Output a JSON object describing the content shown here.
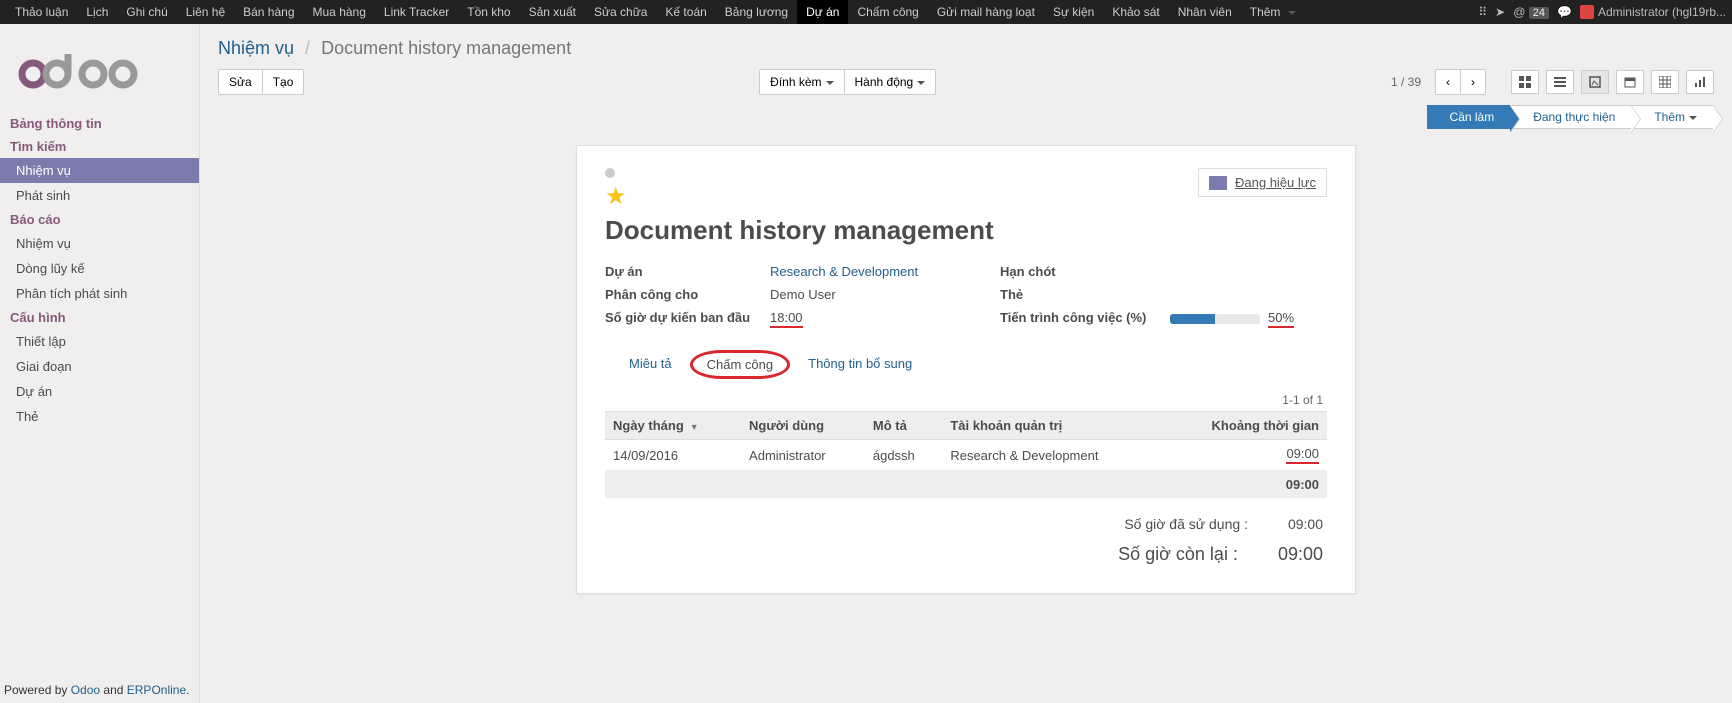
{
  "topmenu": [
    "Thảo luận",
    "Lịch",
    "Ghi chú",
    "Liên hệ",
    "Bán hàng",
    "Mua hàng",
    "Link Tracker",
    "Tồn kho",
    "Sản xuất",
    "Sửa chữa",
    "Kế toán",
    "Bảng lương",
    "Dự án",
    "Chấm công",
    "Gửi mail hàng loạt",
    "Sự kiện",
    "Khảo sát",
    "Nhân viên",
    "Thêm"
  ],
  "topmenu_active_index": 12,
  "sys": {
    "notif_count": "24",
    "user_label": "Administrator (hgl19rb..."
  },
  "sidebar": {
    "sections": [
      {
        "type": "header",
        "label": "Bảng thông tin"
      },
      {
        "type": "header",
        "label": "Tìm kiếm"
      },
      {
        "type": "item",
        "label": "Nhiệm vụ",
        "active": true
      },
      {
        "type": "item",
        "label": "Phát sinh"
      },
      {
        "type": "header",
        "label": "Báo cáo"
      },
      {
        "type": "item",
        "label": "Nhiệm vụ"
      },
      {
        "type": "item",
        "label": "Dòng lũy kế"
      },
      {
        "type": "item",
        "label": "Phân tích phát sinh"
      },
      {
        "type": "header",
        "label": "Cấu hình"
      },
      {
        "type": "item",
        "label": "Thiết lập"
      },
      {
        "type": "item",
        "label": "Giai đoạn"
      },
      {
        "type": "item",
        "label": "Dự án"
      },
      {
        "type": "item",
        "label": "Thẻ"
      }
    ]
  },
  "powered": {
    "prefix": "Powered by ",
    "a1": "Odoo",
    "mid": " and ",
    "a2": "ERPOnline",
    "suffix": "."
  },
  "breadcrumb": {
    "parent": "Nhiệm vụ",
    "current": "Document history management"
  },
  "toolbar": {
    "edit": "Sửa",
    "create": "Tạo",
    "attach": "Đính kèm",
    "action": "Hành động"
  },
  "pager": {
    "text": "1 / 39"
  },
  "status": {
    "stages": [
      "Cần làm",
      "Đang thực hiện",
      "Thêm"
    ],
    "current_index": 0
  },
  "task": {
    "title": "Document history management",
    "stage_button": "Đang hiệu lực",
    "labels": {
      "project": "Dự án",
      "assigned": "Phân công cho",
      "planned_hours": "Số giờ dự kiến ban đầu",
      "deadline": "Hạn chót",
      "tags": "Thẻ",
      "progress": "Tiến trình công việc (%)"
    },
    "project": "Research & Development",
    "assigned_to": "Demo User",
    "planned_hours": "18:00",
    "progress_pct": 50,
    "progress_label": "50%"
  },
  "detail_tabs": [
    "Miêu tả",
    "Chấm công",
    "Thông tin bổ sung"
  ],
  "detail_active_index": 1,
  "timesheet": {
    "meta": "1-1 of 1",
    "columns": [
      "Ngày tháng",
      "Người dùng",
      "Mô tả",
      "Tài khoản quản trị",
      "Khoảng thời gian"
    ],
    "rows": [
      {
        "date": "14/09/2016",
        "user": "Administrator",
        "desc": "ágdssh",
        "account": "Research & Development",
        "duration": "09:00"
      }
    ],
    "footer_total": "09:00"
  },
  "totals": {
    "used_label": "Số giờ đã sử dụng :",
    "used_val": "09:00",
    "remain_label": "Số giờ còn lại :",
    "remain_val": "09:00"
  }
}
